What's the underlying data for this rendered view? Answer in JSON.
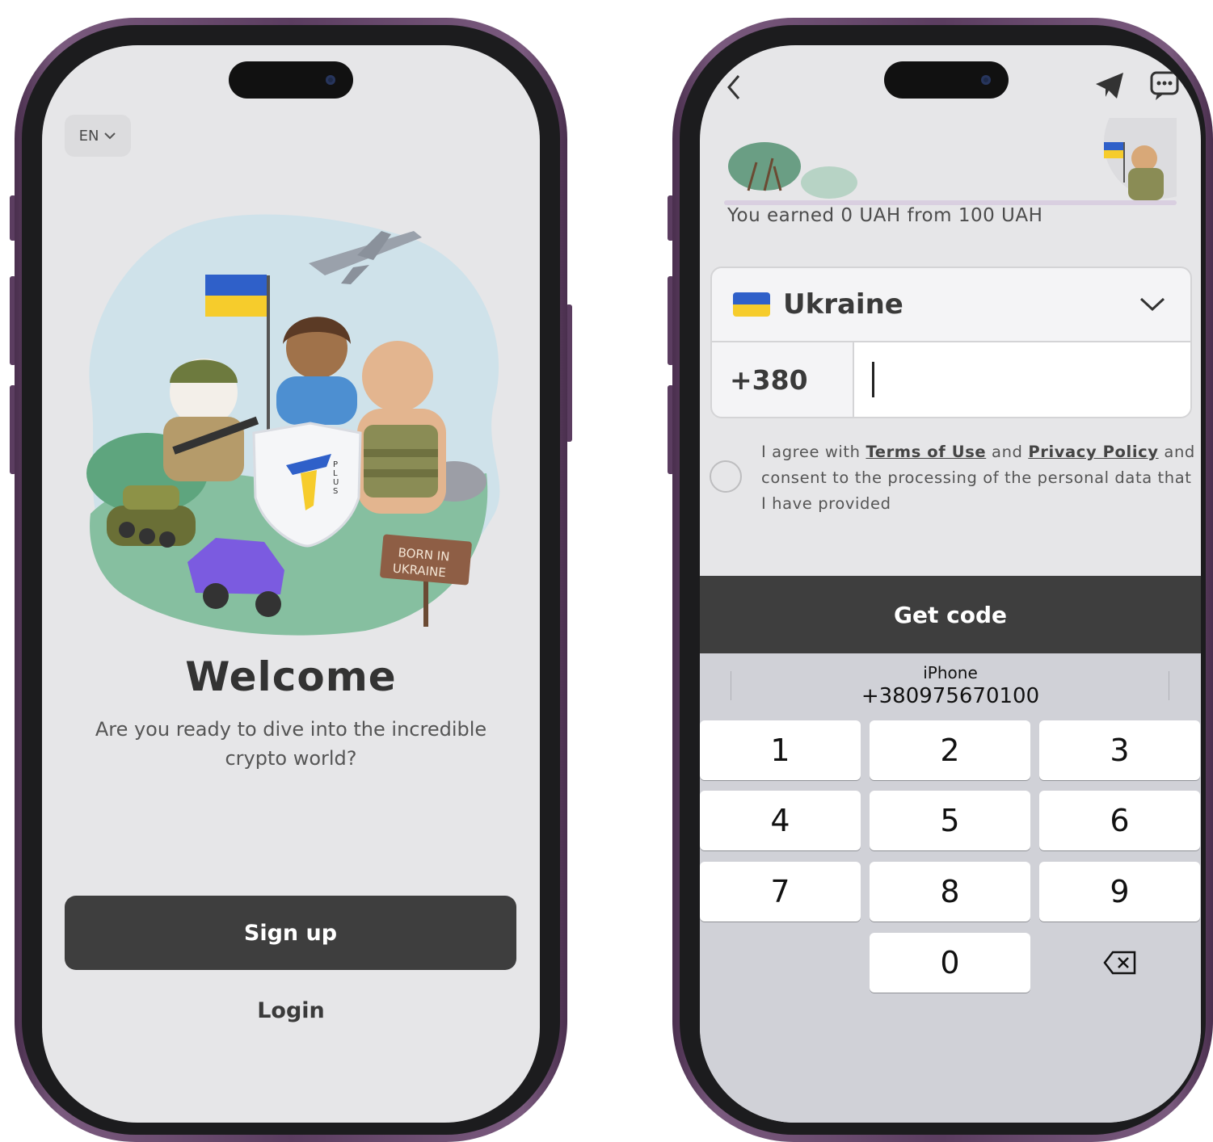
{
  "left_screen": {
    "language": "EN",
    "welcome_title": "Welcome",
    "subtitle": "Are you ready to dive into the incredible crypto world?",
    "signup_label": "Sign up",
    "login_label": "Login",
    "illustration_sign": "BORN IN UKRAINE",
    "shield_text": "PLUS"
  },
  "right_screen": {
    "earned_text": "You earned 0 UAH from 100 UAH",
    "country": "Ukraine",
    "dial_code": "+380",
    "phone_value": "",
    "consent": {
      "prefix": "I agree with ",
      "terms_link": "Terms of Use",
      "middle": " and ",
      "privacy_link": "Privacy Policy",
      "suffix": " and consent to the processing of the personal data that I have provided"
    },
    "get_code_label": "Get code",
    "autofill": {
      "source": "iPhone",
      "number": "+380975670100"
    },
    "keypad": [
      "1",
      "2",
      "3",
      "4",
      "5",
      "6",
      "7",
      "8",
      "9",
      "0"
    ]
  },
  "colors": {
    "button_dark": "#3e3e3e",
    "screen_bg": "#e6e6e8",
    "keyboard_bg": "#d0d1d7",
    "phone_frame": "#5b3d60",
    "flag_blue": "#2f60c9",
    "flag_yellow": "#f6cc2c"
  },
  "icons": [
    "chevron-down-icon",
    "back-icon",
    "telegram-icon",
    "chat-icon",
    "backspace-icon",
    "camera-icon"
  ]
}
